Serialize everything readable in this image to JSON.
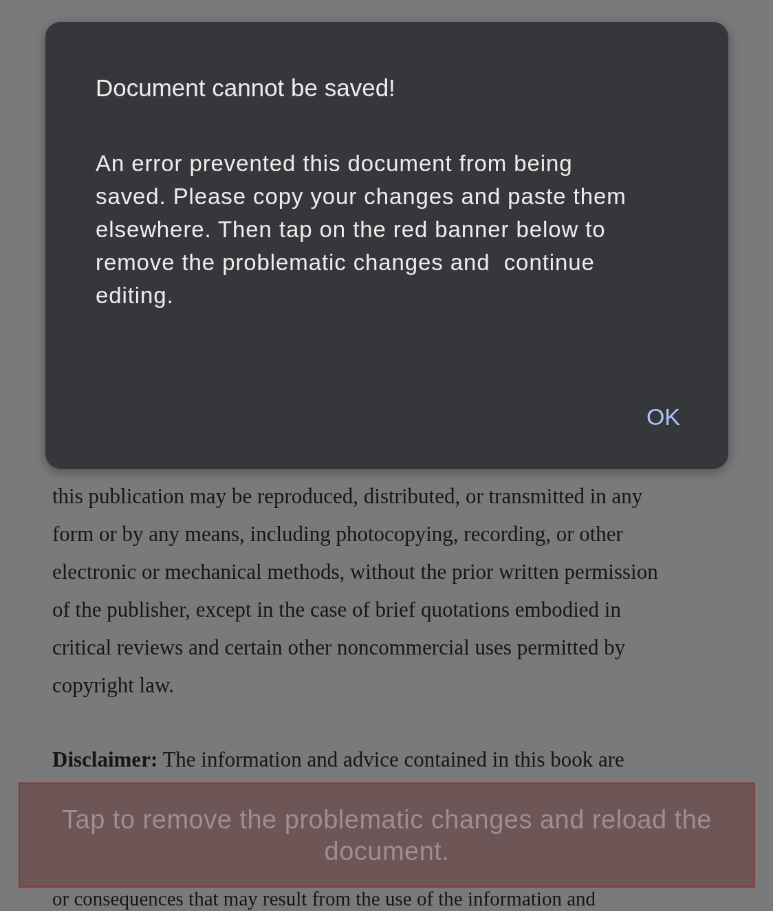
{
  "document": {
    "paragraphs": [
      "this publication may be reproduced, distributed, or transmitted in any form or by any means, including photocopying, recording, or other electronic or mechanical methods, without the prior written permission of the publisher, except in the case of brief quotations embodied in critical reviews and certain other noncommercial uses permitted by copyright law.",
      "**Disclaimer:** The information and advice contained in this book are",
      "or consequences that may result from the use of the information and"
    ]
  },
  "dialog": {
    "title": "Document cannot be saved!",
    "message": "An error prevented this document from being saved. Please copy your changes and paste them elsewhere. Then tap on the red banner below to remove the problematic changes and  continue editing.",
    "buttons": [
      "OK"
    ]
  },
  "error_banner": {
    "text": "Tap to remove the problematic changes and reload the document."
  }
}
